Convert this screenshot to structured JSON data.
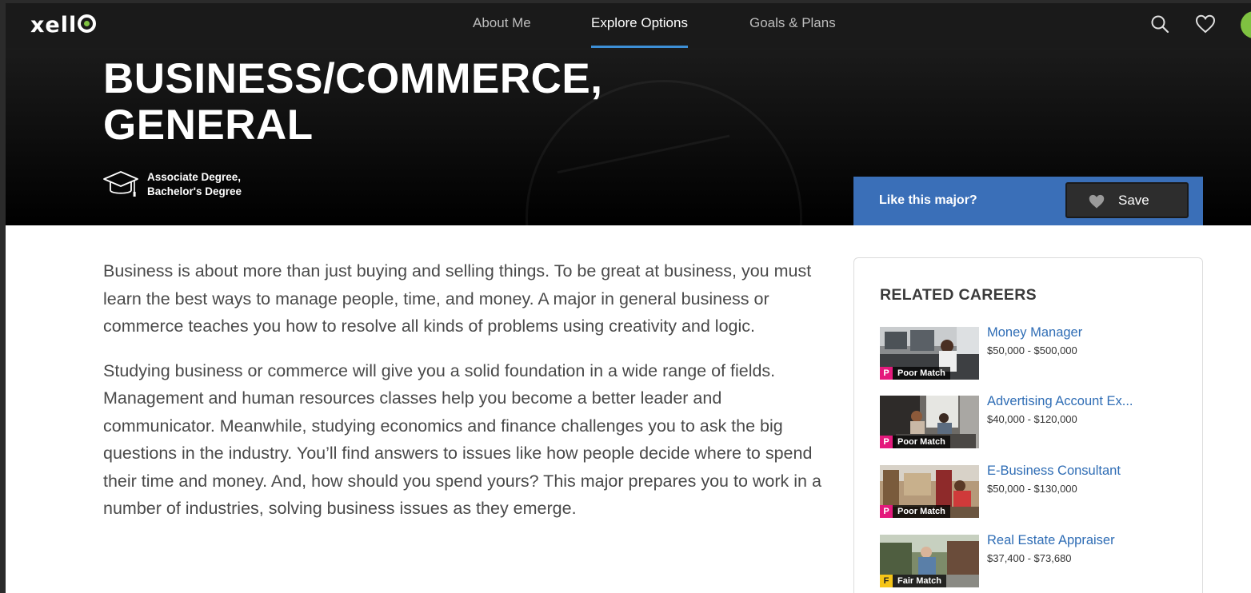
{
  "app": {
    "logo": "xello"
  },
  "nav": {
    "tabs": [
      {
        "label": "About Me",
        "active": false
      },
      {
        "label": "Explore Options",
        "active": true
      },
      {
        "label": "Goals & Plans",
        "active": false
      }
    ],
    "icons": [
      "search-icon",
      "heart-icon",
      "avatar"
    ]
  },
  "hero": {
    "title": "BUSINESS/COMMERCE, GENERAL",
    "degree_line1": "Associate Degree,",
    "degree_line2": "Bachelor's Degree"
  },
  "like": {
    "question": "Like this major?",
    "save_label": "Save"
  },
  "description": {
    "p1": "Business is about more than just buying and selling things. To be great at business, you must learn the best ways to manage people, time, and money. A major in general business or commerce teaches you how to resolve all kinds of problems using creativity and logic.",
    "p2": "Studying business or commerce will give you a solid foundation in a wide range of fields. Management and human resources classes help you become a better leader and communicator. Meanwhile, studying economics and finance challenges you to ask the big questions in the industry. You’ll find answers to issues like how people decide where to spend their time and money. And, how should you spend yours? This major prepares you to work in a number of industries, solving business issues as they emerge."
  },
  "related": {
    "title": "RELATED CAREERS",
    "careers": [
      {
        "name": "Money Manager",
        "salary": "$50,000 - $500,000",
        "match_letter": "P",
        "match_label": "Poor Match"
      },
      {
        "name": "Advertising Account Ex...",
        "salary": "$40,000 - $120,000",
        "match_letter": "P",
        "match_label": "Poor Match"
      },
      {
        "name": "E-Business Consultant",
        "salary": "$50,000 - $130,000",
        "match_letter": "P",
        "match_label": "Poor Match"
      },
      {
        "name": "Real Estate Appraiser",
        "salary": "$37,400 - $73,680",
        "match_letter": "F",
        "match_label": "Fair Match"
      }
    ]
  },
  "colors": {
    "accent": "#3d8fd6",
    "like_bar": "#3a6fb8",
    "link": "#2f6db5",
    "poor_match": "#e4197c",
    "fair_match": "#f5c518",
    "logo_dot": "#7fc241"
  }
}
